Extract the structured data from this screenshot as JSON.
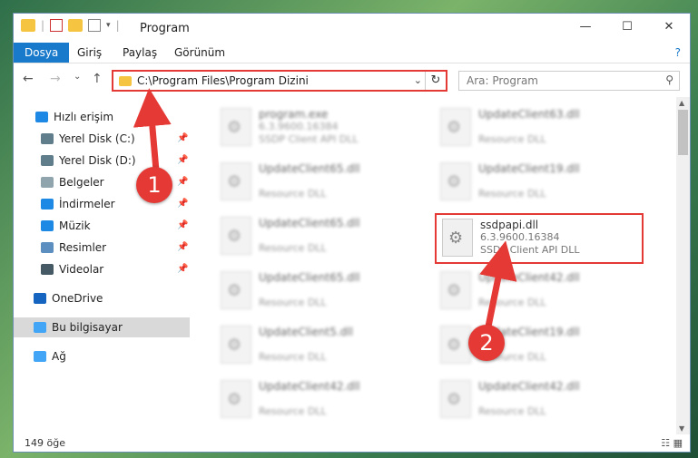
{
  "titlebar": {
    "title": "Program",
    "minimize": "—",
    "maximize": "☐",
    "close": "✕"
  },
  "ribbon": {
    "tabs": [
      {
        "label": "Dosya",
        "active": true
      },
      {
        "label": "Giriş",
        "active": false
      },
      {
        "label": "Paylaş",
        "active": false
      },
      {
        "label": "Görünüm",
        "active": false
      }
    ],
    "help": "?"
  },
  "navigation": {
    "back": "←",
    "forward": "→",
    "recent": "⌄",
    "up": "↑",
    "address": "C:\\Program Files\\Program Dizini",
    "dropdown": "⌄",
    "refresh": "↻",
    "search_placeholder": "Ara: Program"
  },
  "sidebar": {
    "items": [
      {
        "label": "Hızlı erişim",
        "icon": "star-icon",
        "color": "#1e88e5",
        "pinned": false
      },
      {
        "label": "Yerel Disk (C:)",
        "icon": "drive-icon",
        "color": "#607d8b",
        "pinned": true
      },
      {
        "label": "Yerel Disk (D:)",
        "icon": "drive-icon",
        "color": "#607d8b",
        "pinned": true
      },
      {
        "label": "Belgeler",
        "icon": "documents-icon",
        "color": "#90a4ae",
        "pinned": true
      },
      {
        "label": "İndirmeler",
        "icon": "downloads-icon",
        "color": "#1e88e5",
        "pinned": true
      },
      {
        "label": "Müzik",
        "icon": "music-icon",
        "color": "#1e88e5",
        "pinned": true
      },
      {
        "label": "Resimler",
        "icon": "pictures-icon",
        "color": "#5c8fbf",
        "pinned": true
      },
      {
        "label": "Videolar",
        "icon": "videos-icon",
        "color": "#455a64",
        "pinned": true
      },
      {
        "label": "OneDrive",
        "icon": "cloud-icon",
        "color": "#1565c0",
        "pinned": false
      },
      {
        "label": "Bu bilgisayar",
        "icon": "computer-icon",
        "color": "#42a5f5",
        "pinned": false,
        "selected": true
      },
      {
        "label": "Ağ",
        "icon": "network-icon",
        "color": "#42a5f5",
        "pinned": false
      }
    ],
    "pin_glyph": "📌"
  },
  "files": [
    {
      "name": "program.exe",
      "version": "6.3.9600.16384",
      "desc": "SSDP Client API DLL",
      "blur": true
    },
    {
      "name": "UpdateClient63.dll",
      "version": "",
      "desc": "Resource DLL",
      "blur": true
    },
    {
      "name": "UpdateClient65.dll",
      "version": "",
      "desc": "Resource DLL",
      "blur": true
    },
    {
      "name": "UpdateClient19.dll",
      "version": "",
      "desc": "Resource DLL",
      "blur": true
    },
    {
      "name": "UpdateClient65.dll",
      "version": "",
      "desc": "Resource DLL",
      "blur": true
    },
    {
      "name": "ssdpapi.dll",
      "version": "6.3.9600.16384",
      "desc": "SSDP Client API DLL",
      "blur": false,
      "highlight": true
    },
    {
      "name": "UpdateClient65.dll",
      "version": "",
      "desc": "Resource DLL",
      "blur": true
    },
    {
      "name": "UpdateClient42.dll",
      "version": "",
      "desc": "Resource DLL",
      "blur": true
    },
    {
      "name": "UpdateClient5.dll",
      "version": "",
      "desc": "Resource DLL",
      "blur": true
    },
    {
      "name": "UpdateClient19.dll",
      "version": "",
      "desc": "Resource DLL",
      "blur": true
    },
    {
      "name": "UpdateClient42.dll",
      "version": "",
      "desc": "Resource DLL",
      "blur": true
    },
    {
      "name": "UpdateClient42.dll",
      "version": "",
      "desc": "Resource DLL",
      "blur": true
    }
  ],
  "status": {
    "count": "149 öğe",
    "views": "☷ ▦"
  },
  "annotations": [
    {
      "number": "1",
      "color": "#e53935"
    },
    {
      "number": "2",
      "color": "#e53935"
    }
  ]
}
